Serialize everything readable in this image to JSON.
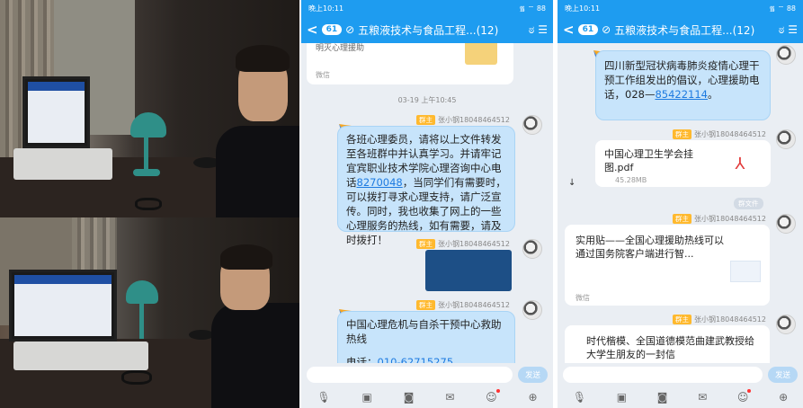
{
  "phone1": {
    "status_time": "晚上10:11",
    "status_icons": "᯾ ⌔ 88",
    "back_label": "<",
    "unread": "61",
    "chat_title": "五粮液技术与食品工程...(12)",
    "earlier_text": "明灭心理援助",
    "earlier_src": "微信",
    "timestamp": "03-19 上午10:45",
    "sender_role": "群主",
    "sender_name": "张小钢18048464512",
    "msg1_a": "各班心理委员，请将以上文件转发至各班群中并认真学习。并请牢记宜宾职业技术学院心理咨询中心电话",
    "msg1_link": "8270048",
    "msg1_b": "，当同学们有需要时，可以拨打寻求心理支持，请广泛宣传。同时，我也收集了网上的一些心理服务的热线，如有需要，请及时拨打！",
    "msg3_a": "中国心理危机与自杀干预中心救助热线",
    "msg3_b": "电话：",
    "msg3_link": "010-62715275",
    "send_label": "发送"
  },
  "phone2": {
    "status_time": "晚上10:11",
    "status_icons": "᯾ ⌔ 88",
    "back_label": "<",
    "unread": "61",
    "chat_title": "五粮液技术与食品工程...(12)",
    "msg_top_a": "四川新型冠状病毒肺炎疫情心理干预工作组发出的倡议，心理援助电话，028—",
    "msg_top_link": "85422114",
    "msg_top_b": "。",
    "sender_role": "群主",
    "sender_name": "张小钢18048464512",
    "file_name": "中国心理卫生学会挂图.pdf",
    "file_size": "45.28MB",
    "file_tag": "群文件",
    "card_title": "实用贴——全国心理援助热线可以通过国务院客户端进行智...",
    "card_src": "微信",
    "msg_bottom": "时代楷模、全国道德模范曲建武教授给大学生朋友的一封信",
    "send_label": "发送"
  }
}
